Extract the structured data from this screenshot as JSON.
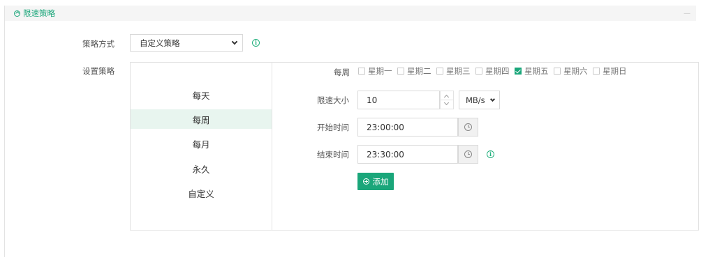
{
  "section": {
    "title": "限速策略",
    "collapse_mark": "—"
  },
  "policy_mode": {
    "label": "策略方式",
    "value": "自定义策略"
  },
  "set_policy": {
    "label": "设置策略"
  },
  "schedule_types": [
    {
      "label": "每天",
      "active": false
    },
    {
      "label": "每周",
      "active": true
    },
    {
      "label": "每月",
      "active": false
    },
    {
      "label": "永久",
      "active": false
    },
    {
      "label": "自定义",
      "active": false
    }
  ],
  "weekly": {
    "label": "每周",
    "days": [
      {
        "label": "星期一",
        "checked": false
      },
      {
        "label": "星期二",
        "checked": false
      },
      {
        "label": "星期三",
        "checked": false
      },
      {
        "label": "星期四",
        "checked": false
      },
      {
        "label": "星期五",
        "checked": true
      },
      {
        "label": "星期六",
        "checked": false
      },
      {
        "label": "星期日",
        "checked": false
      }
    ]
  },
  "speed_limit": {
    "label": "限速大小",
    "value": "10",
    "unit": "MB/s"
  },
  "start_time": {
    "label": "开始时间",
    "value": "23:00:00"
  },
  "end_time": {
    "label": "结束时间",
    "value": "23:30:00"
  },
  "add_button": {
    "label": "添加"
  },
  "colors": {
    "accent": "#1aa67a",
    "active_row": "#e8f5ef"
  }
}
